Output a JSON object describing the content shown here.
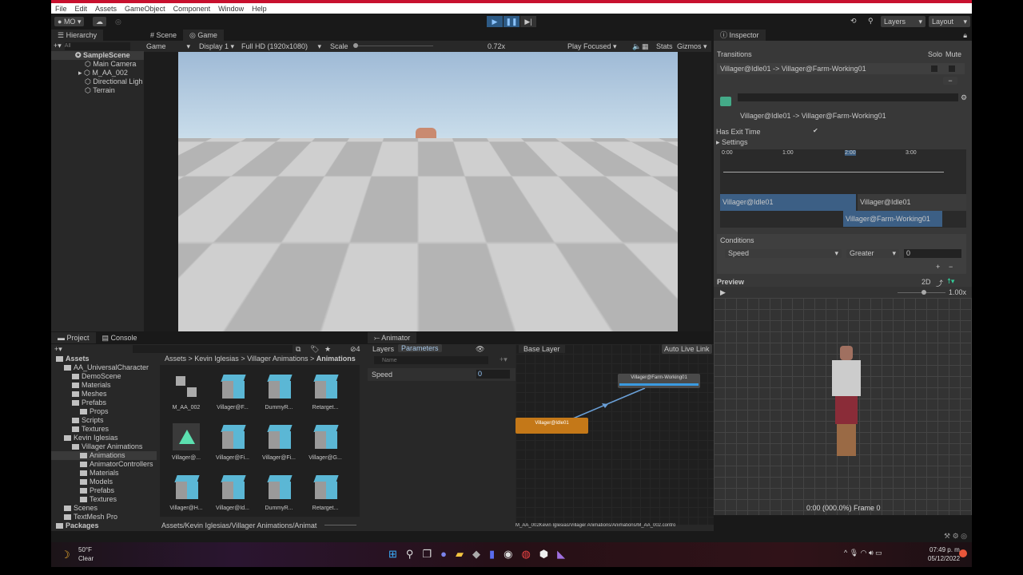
{
  "menu": [
    "File",
    "Edit",
    "Assets",
    "GameObject",
    "Component",
    "Window",
    "Help"
  ],
  "toolbar": {
    "account": "MO",
    "layers": "Layers",
    "layout": "Layout"
  },
  "hierarchy": {
    "title": "Hierarchy",
    "search_placeholder": "All",
    "scene": "SampleScene",
    "items": [
      "Main Camera",
      "M_AA_002",
      "Directional Ligh",
      "Terrain"
    ]
  },
  "gameview": {
    "tabs": [
      "Scene",
      "Game"
    ],
    "mode": "Game",
    "display": "Display 1",
    "resolution": "Full HD (1920x1080)",
    "scale_label": "Scale",
    "scale_value": "0.72x",
    "play_focused": "Play Focused",
    "stats": "Stats",
    "gizmos": "Gizmos"
  },
  "inspector": {
    "title": "Inspector",
    "transitions_label": "Transitions",
    "solo": "Solo",
    "mute": "Mute",
    "transition": "Villager@Idle01 -> Villager@Farm-Working01",
    "has_exit_time": "Has Exit Time",
    "settings": "Settings",
    "timeline_ticks": [
      "0:00",
      "1:00",
      "2:00",
      "3:00"
    ],
    "clip_a": "Villager@Idle01",
    "clip_a2": "Villager@Idle01",
    "clip_b": "Villager@Farm-Working01",
    "conditions": "Conditions",
    "cond_param": "Speed",
    "cond_op": "Greater",
    "cond_value": "0",
    "preview": "Preview",
    "preview_2d": "2D",
    "preview_speed": "1.00x",
    "preview_frame": "0:00 (000.0%) Frame 0"
  },
  "project": {
    "tabs": [
      "Project",
      "Console"
    ],
    "filter_count": "4",
    "tree": [
      {
        "label": "Assets",
        "depth": 0,
        "bold": true
      },
      {
        "label": "AA_UniversalCharacter",
        "depth": 1
      },
      {
        "label": "DemoScene",
        "depth": 2
      },
      {
        "label": "Materials",
        "depth": 2
      },
      {
        "label": "Meshes",
        "depth": 2
      },
      {
        "label": "Prefabs",
        "depth": 2
      },
      {
        "label": "Props",
        "depth": 3
      },
      {
        "label": "Scripts",
        "depth": 2
      },
      {
        "label": "Textures",
        "depth": 2
      },
      {
        "label": "Kevin Iglesias",
        "depth": 1
      },
      {
        "label": "Villager Animations",
        "depth": 2
      },
      {
        "label": "Animations",
        "depth": 3,
        "selected": true
      },
      {
        "label": "AnimatorControllers",
        "depth": 3
      },
      {
        "label": "Materials",
        "depth": 3
      },
      {
        "label": "Models",
        "depth": 3
      },
      {
        "label": "Prefabs",
        "depth": 3
      },
      {
        "label": "Textures",
        "depth": 3
      },
      {
        "label": "Scenes",
        "depth": 1
      },
      {
        "label": "TextMesh Pro",
        "depth": 1
      },
      {
        "label": "Packages",
        "depth": 0,
        "bold": true
      }
    ],
    "breadcrumb": [
      "Assets",
      "Kevin Iglesias",
      "Villager Animations",
      "Animations"
    ],
    "assets": [
      "M_AA_002",
      "Villager@F...",
      "DummyR...",
      "Retarget...",
      "Villager@...",
      "Villager@Fi...",
      "Villager@Fi...",
      "Villager@G...",
      "Villager@H...",
      "Villager@Id...",
      "DummyR...",
      "Retarget..."
    ],
    "path": "Assets/Kevin Iglesias/Villager Animations/Animat"
  },
  "animator": {
    "title": "Animator",
    "tabs": [
      "Layers",
      "Parameters"
    ],
    "search_placeholder": "Name",
    "param": "Speed",
    "param_value": "0",
    "layer": "Base Layer",
    "auto_live_link": "Auto Live Link",
    "state_a": "Villager@Idle01",
    "state_b": "Villager@Farm-Working01",
    "status": "M_AA_002Kevin Iglesias/Villager Animations/Animations/M_AA_002.contro"
  },
  "taskbar": {
    "temp": "50°F",
    "weather": "Clear",
    "time": "07:49 p. m.",
    "date": "05/12/2022"
  }
}
